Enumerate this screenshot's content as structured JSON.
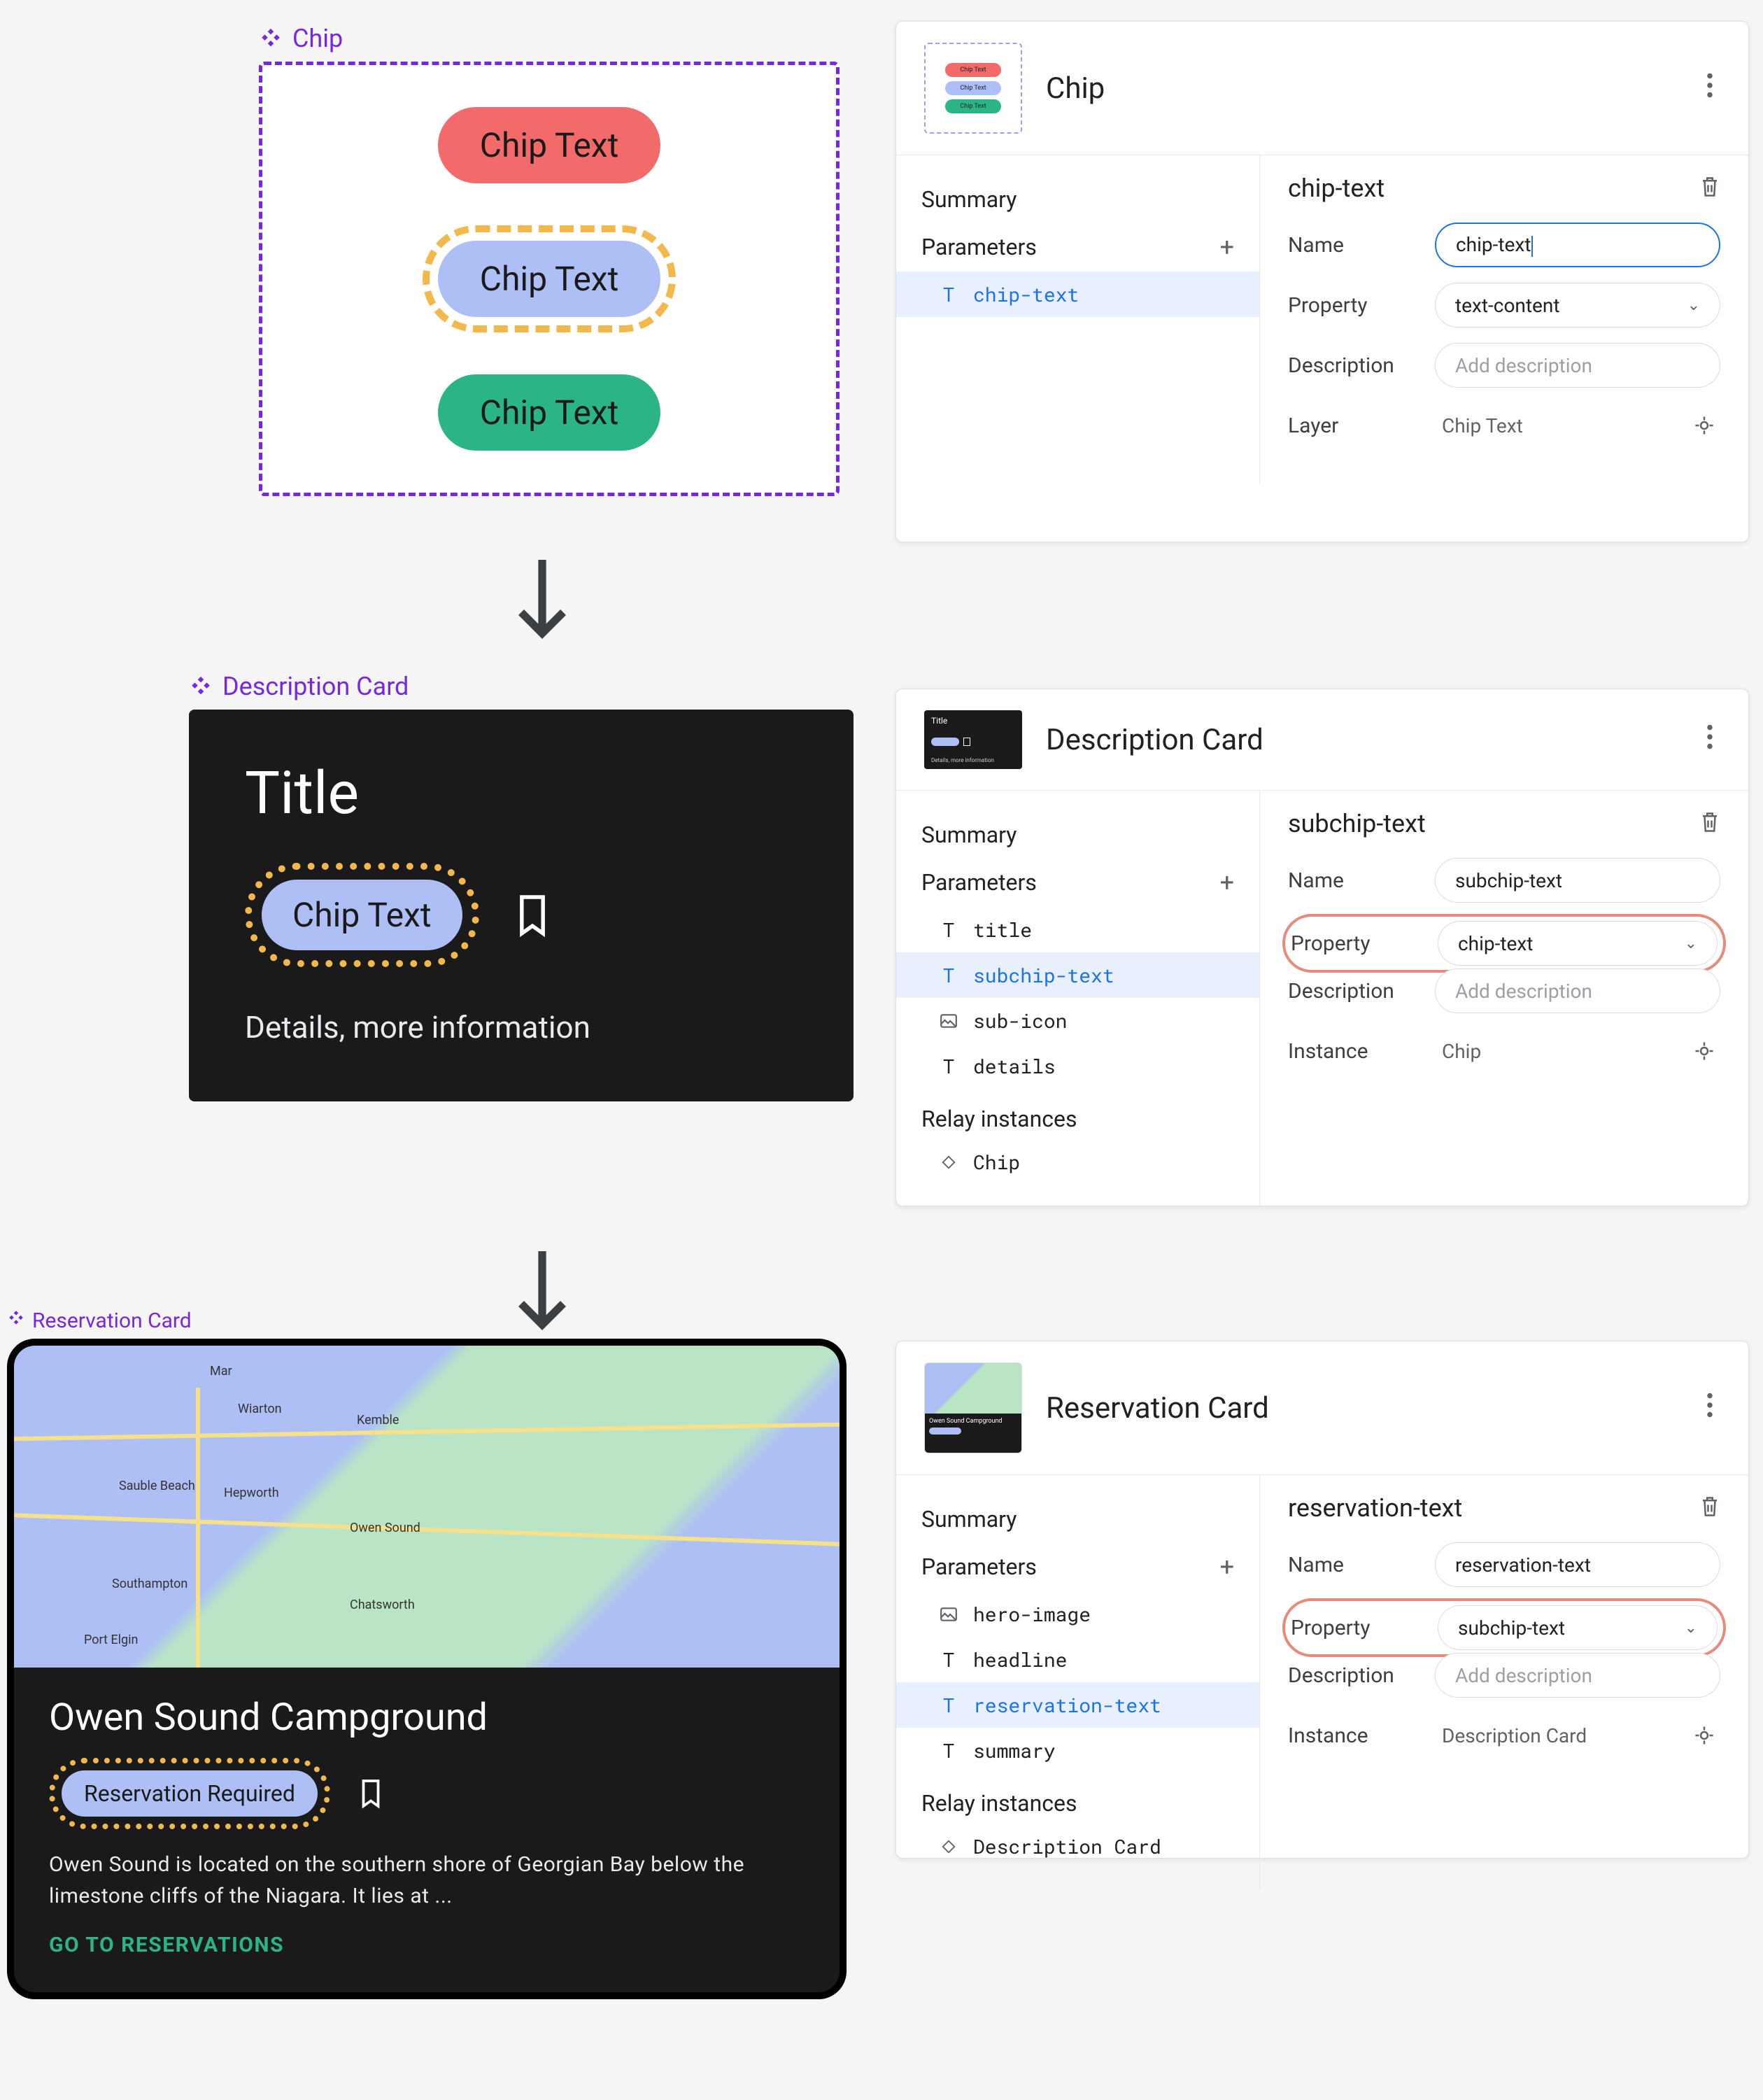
{
  "chip_preview": {
    "label": "Chip",
    "variants": [
      "Chip Text",
      "Chip Text",
      "Chip Text"
    ]
  },
  "desc_preview": {
    "label": "Description Card",
    "title": "Title",
    "chip_text": "Chip Text",
    "details": "Details, more information"
  },
  "res_preview": {
    "label": "Reservation Card",
    "map_towns": [
      "Mar",
      "Wiarton",
      "Kemble",
      "Sauble Beach",
      "Hepworth",
      "Owen Sound",
      "Southampton",
      "Chatsworth",
      "Port Elgin"
    ],
    "headline": "Owen Sound Campground",
    "chip_text": "Reservation Required",
    "summary": "Owen Sound is located on the southern shore of Georgian Bay below the limestone cliffs of the Niagara. It lies at ...",
    "cta": "GO TO RESERVATIONS"
  },
  "panel_chip": {
    "title": "Chip",
    "left": {
      "summary": "Summary",
      "parameters": "Parameters",
      "items": [
        {
          "icon": "T",
          "name": "chip-text",
          "selected": true
        }
      ]
    },
    "right": {
      "field_title": "chip-text",
      "name_label": "Name",
      "name_value": "chip-text",
      "property_label": "Property",
      "property_value": "text-content",
      "description_label": "Description",
      "description_placeholder": "Add description",
      "layer_label": "Layer",
      "layer_value": "Chip Text"
    }
  },
  "panel_desc": {
    "title": "Description Card",
    "left": {
      "summary": "Summary",
      "parameters": "Parameters",
      "items": [
        {
          "icon": "T",
          "name": "title"
        },
        {
          "icon": "T",
          "name": "subchip-text",
          "selected": true
        },
        {
          "icon": "img",
          "name": "sub-icon"
        },
        {
          "icon": "T",
          "name": "details"
        }
      ],
      "relay_header": "Relay instances",
      "relay_items": [
        {
          "icon": "diamond",
          "name": "Chip"
        }
      ]
    },
    "right": {
      "field_title": "subchip-text",
      "name_label": "Name",
      "name_value": "subchip-text",
      "property_label": "Property",
      "property_value": "chip-text",
      "description_label": "Description",
      "description_placeholder": "Add description",
      "instance_label": "Instance",
      "instance_value": "Chip"
    }
  },
  "panel_res": {
    "title": "Reservation Card",
    "left": {
      "summary": "Summary",
      "parameters": "Parameters",
      "items": [
        {
          "icon": "img",
          "name": "hero-image"
        },
        {
          "icon": "T",
          "name": "headline"
        },
        {
          "icon": "T",
          "name": "reservation-text",
          "selected": true
        },
        {
          "icon": "T",
          "name": "summary"
        }
      ],
      "relay_header": "Relay instances",
      "relay_items": [
        {
          "icon": "diamond",
          "name": "Description Card"
        }
      ]
    },
    "right": {
      "field_title": "reservation-text",
      "name_label": "Name",
      "name_value": "reservation-text",
      "property_label": "Property",
      "property_value": "subchip-text",
      "description_label": "Description",
      "description_placeholder": "Add description",
      "instance_label": "Instance",
      "instance_value": "Description Card"
    }
  }
}
